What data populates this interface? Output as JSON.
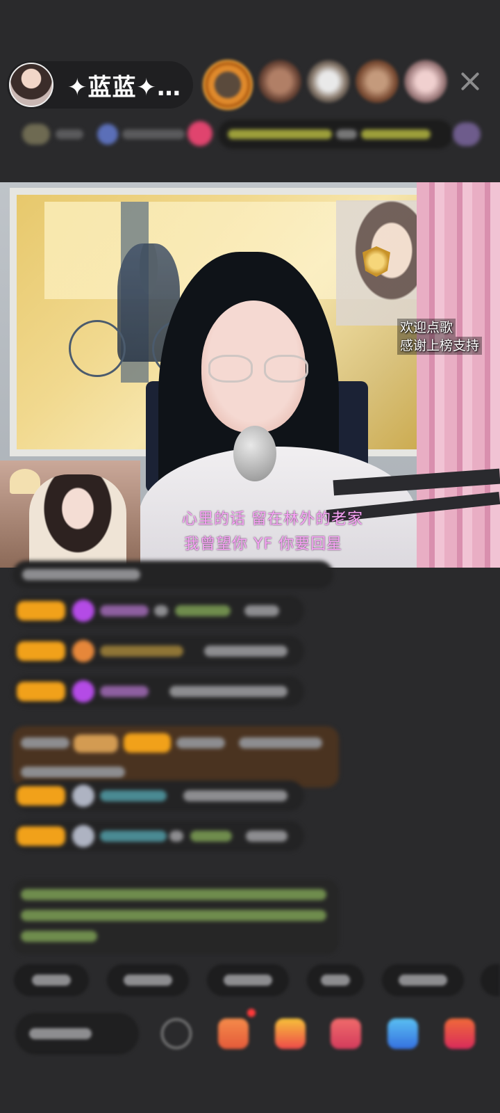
{
  "header": {
    "host_name": "✦蓝蓝✦…",
    "close_label": "×"
  },
  "video": {
    "overlay_welcome": "欢迎点歌",
    "overlay_thanks": "感谢上榜支持",
    "lyric_line1": "心里的话 留在林外的老家",
    "lyric_line2": "我曾望你 YF 你要回星"
  },
  "colors": {
    "background": "#2a2a2c",
    "lyric": "#f7a3f5",
    "accent_gold": "#f1a11a",
    "accent_purple": "#b44be6"
  },
  "icons": [
    "close-icon",
    "gift-icon",
    "emoji-icon"
  ]
}
